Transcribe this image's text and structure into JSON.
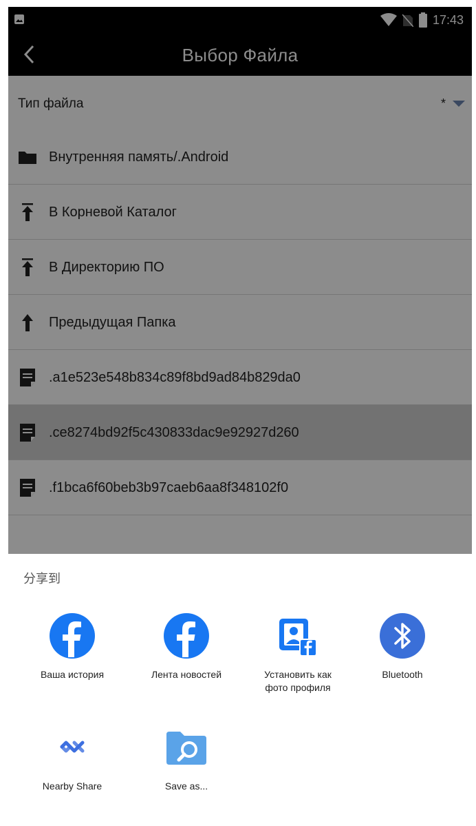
{
  "status_bar": {
    "time": "17:43"
  },
  "app_bar": {
    "title": "Выбор Файла"
  },
  "file_type": {
    "label": "Тип файла",
    "value": "*"
  },
  "rows": [
    {
      "label": "Внутренняя память/.Android",
      "icon": "folder-icon"
    },
    {
      "label": "В Корневой Каталог",
      "icon": "arrow-up-bar-icon"
    },
    {
      "label": "В Директорию ПО",
      "icon": "arrow-up-bar-icon"
    },
    {
      "label": "Предыдущая Папка",
      "icon": "arrow-up-icon"
    },
    {
      "label": ".a1e523e548b834c89f8bd9ad84b829da0",
      "icon": "file-icon"
    },
    {
      "label": ".ce8274bd92f5c430833dac9e92927d260",
      "icon": "file-icon",
      "selected": true
    },
    {
      "label": ".f1bca6f60beb3b97caeb6aa8f348102f0",
      "icon": "file-icon"
    }
  ],
  "share_sheet": {
    "heading": "分享到",
    "apps": [
      {
        "label": "Ваша история",
        "icon": "facebook-icon"
      },
      {
        "label": "Лента новостей",
        "icon": "facebook-icon"
      },
      {
        "label_line1": "Установить как",
        "label_line2": "фото профиля",
        "icon": "facebook-profile-photo-icon"
      },
      {
        "label": "Bluetooth",
        "icon": "bluetooth-icon"
      },
      {
        "label": "Nearby Share",
        "icon": "nearby-share-icon"
      },
      {
        "label": "Save as...",
        "icon": "save-as-folder-icon"
      }
    ]
  },
  "colors": {
    "facebook_blue": "#1877f2",
    "bluetooth_blue": "#3a6fd8",
    "folder_blue": "#5aa3e8",
    "nearby_blue": "#3d6fe0"
  }
}
